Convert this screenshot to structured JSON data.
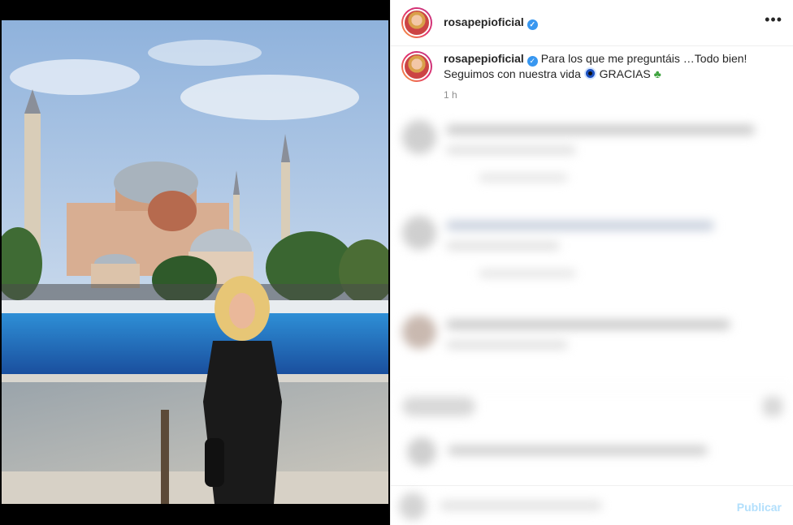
{
  "post": {
    "username": "rosapepioficial",
    "verified_icon": "verified-badge-icon",
    "more_icon": "more-options-icon"
  },
  "caption": {
    "username": "rosapepioficial",
    "text_part1": "Para los que me preguntáis …Todo bien! Seguimos con nuestra vida",
    "text_part2": "GRACIAS",
    "emoji1": "nazar-amulet-icon",
    "emoji2": "four-leaf-clover-icon",
    "time": "1 h"
  },
  "comment_box": {
    "publish_label": "Publicar"
  },
  "colors": {
    "verified": "#3897f0",
    "publish_disabled": "#b2dffc",
    "divider": "#efefef"
  }
}
